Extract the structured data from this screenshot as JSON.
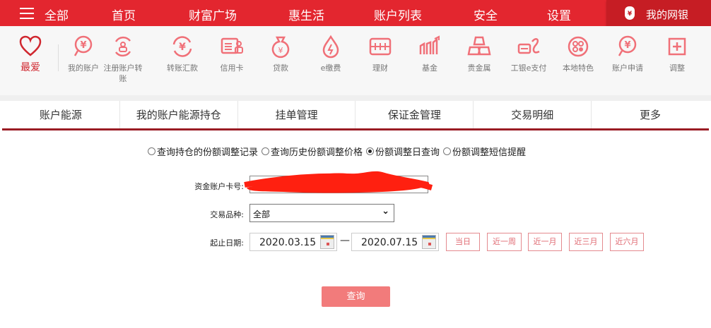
{
  "topnav": {
    "menu": "全部",
    "items": [
      "首页",
      "财富广场",
      "惠生活",
      "账户列表",
      "安全",
      "设置"
    ],
    "mybank": "我的网银"
  },
  "shortcuts": {
    "favorite": "最爱",
    "items": [
      "我的账户",
      "注册账户转账",
      "转账汇款",
      "信用卡",
      "贷款",
      "e缴费",
      "理财",
      "基金",
      "贵金属",
      "工银e支付",
      "本地特色",
      "账户申请",
      "调整"
    ]
  },
  "tabs": [
    "账户能源",
    "我的账户能源持仓",
    "挂单管理",
    "保证金管理",
    "交易明细",
    "更多"
  ],
  "form": {
    "radios": [
      {
        "label": "查询持仓的份额调整记录",
        "checked": false
      },
      {
        "label": "查询历史份额调整价格",
        "checked": false
      },
      {
        "label": "份额调整日查询",
        "checked": true
      },
      {
        "label": "份额调整短信提醒",
        "checked": false
      }
    ],
    "account_label": "资金账户卡号:",
    "variety_label": "交易品种:",
    "variety_value": "全部",
    "date_label": "起止日期:",
    "start_date": "2020.03.15",
    "end_date": "2020.07.15",
    "date_sep": "—",
    "quick": [
      "当日",
      "近一周",
      "近一月",
      "近三月",
      "近六月"
    ],
    "submit": "查询"
  },
  "colors": {
    "brand": "#e3262f",
    "tab_underline": "#9a1b24",
    "icon": "#f07078"
  }
}
